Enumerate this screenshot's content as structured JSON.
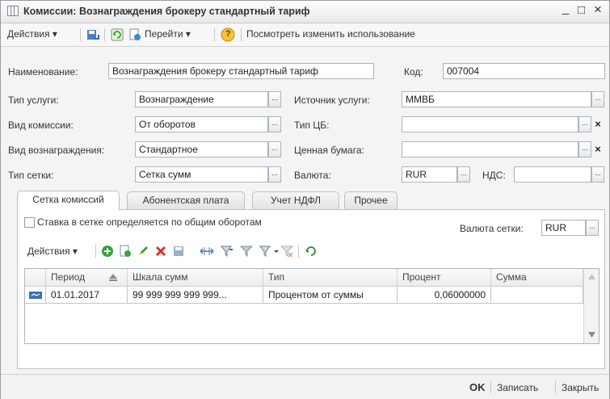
{
  "window": {
    "title": "Комиссии: Вознаграждения брокеру стандартный тариф",
    "minimize": "_",
    "maximize": "□",
    "close": "×"
  },
  "toolbar": {
    "actions": "Действия ▾",
    "goto": "Перейти ▾",
    "help": "?",
    "view_usage": "Посмотреть изменить использование"
  },
  "form": {
    "name_label": "Наименование:",
    "name_value": "Вознаграждения брокеру стандартный тариф",
    "code_label": "Код:",
    "code_value": "007004",
    "service_type_label": "Тип услуги:",
    "service_type_value": "Вознаграждение",
    "service_source_label": "Источник услуги:",
    "service_source_value": "ММВБ",
    "commission_kind_label": "Вид комиссии:",
    "commission_kind_value": "От оборотов",
    "security_type_label": "Тип ЦБ:",
    "security_type_value": "",
    "reward_kind_label": "Вид вознаграждения:",
    "reward_kind_value": "Стандартное",
    "security_label": "Ценная бумага:",
    "security_value": "",
    "grid_type_label": "Тип сетки:",
    "grid_type_value": "Сетка сумм",
    "currency_label": "Валюта:",
    "currency_value": "RUR",
    "vat_label": "НДС:",
    "vat_value": "",
    "ellipsis": "...",
    "clear": "×"
  },
  "tabs": [
    "Сетка комиссий",
    "Абонентская плата",
    "Учет НДФЛ",
    "Прочее"
  ],
  "commission_grid": {
    "checkbox_label": "Ставка в сетке определяется по общим оборотам",
    "checkbox_checked": false,
    "grid_currency_label": "Валюта сетки:",
    "grid_currency_value": "RUR",
    "actions": "Действия ▾",
    "columns": [
      "Период",
      "Шкала сумм",
      "Тип",
      "Процент",
      "Сумма"
    ],
    "rows": [
      {
        "period": "01.01.2017",
        "scale": "99 999 999 999 999...",
        "type": "Процентом от суммы",
        "percent": "0,06000000",
        "sum": ""
      }
    ]
  },
  "footer": {
    "ok": "OK",
    "save": "Записать",
    "close": "Закрыть"
  }
}
